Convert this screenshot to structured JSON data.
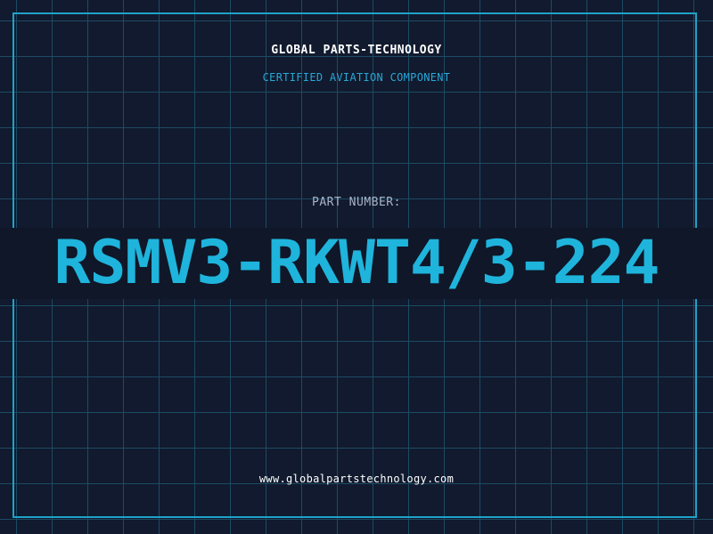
{
  "header": {
    "company_name": "GLOBAL PARTS-TECHNOLOGY",
    "subtitle": "CERTIFIED AVIATION COMPONENT"
  },
  "part": {
    "label": "PART NUMBER:",
    "number": "RSMV3-RKWT4/3-224"
  },
  "footer": {
    "website": "www.globalpartstechnology.com"
  },
  "colors": {
    "background": "#111a2e",
    "grid": "#1d4b63",
    "accent": "#1fb4dc",
    "frame": "#1fa2c8"
  }
}
